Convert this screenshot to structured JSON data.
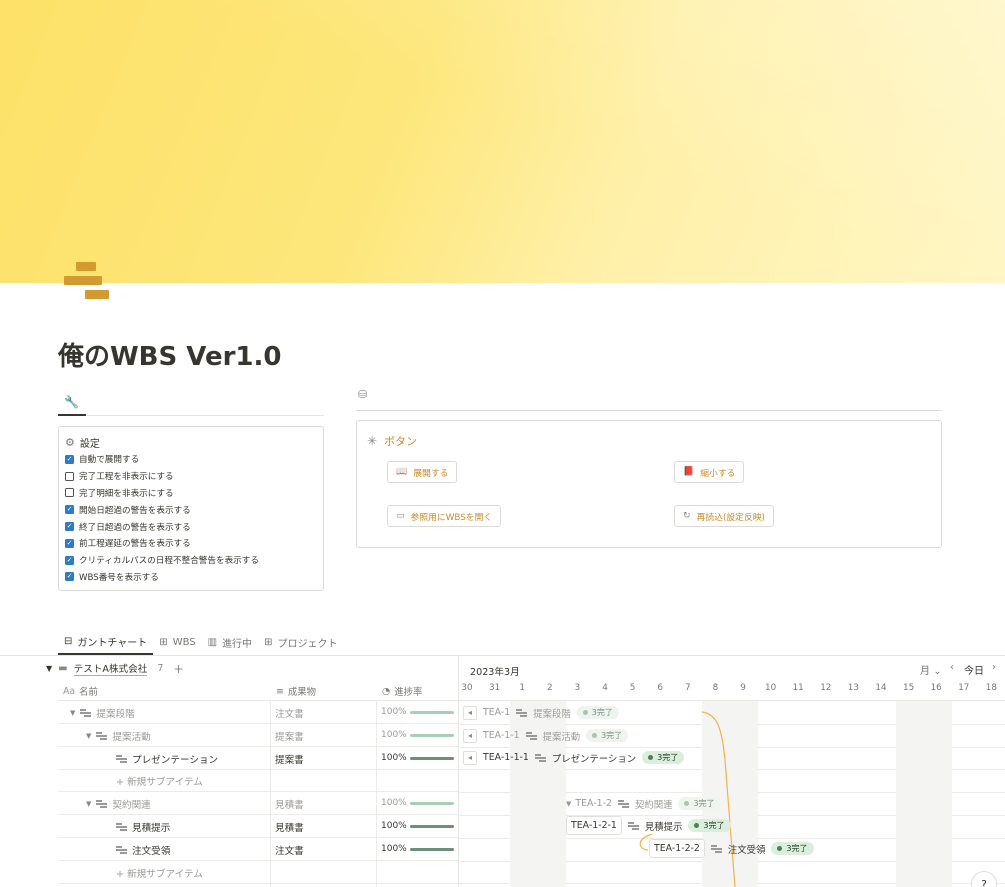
{
  "page": {
    "title": "俺のWBS Ver1.0"
  },
  "settings": {
    "tab_icon": "wrench-icon",
    "heading": "設定",
    "options": [
      {
        "label": "自動で展開する",
        "checked": true
      },
      {
        "label": "完了工程を非表示にする",
        "checked": false
      },
      {
        "label": "完了明細を非表示にする",
        "checked": false
      },
      {
        "label": "開始日超過の警告を表示する",
        "checked": true
      },
      {
        "label": "終了日超過の警告を表示する",
        "checked": true
      },
      {
        "label": "前工程遅延の警告を表示する",
        "checked": true
      },
      {
        "label": "クリティカルパスの日程不整合警告を表示する",
        "checked": true
      },
      {
        "label": "WBS番号を表示する",
        "checked": true
      }
    ]
  },
  "buttons": {
    "title": "ボタン",
    "expand": "展開する",
    "collapse": "縮小する",
    "open_ref": "参照用にWBSを開く",
    "reload": "再読込(設定反映)"
  },
  "views": [
    "ガントチャート",
    "WBS",
    "進行中",
    "プロジェクト"
  ],
  "table": {
    "group": {
      "name": "テストA株式会社",
      "count": "7"
    },
    "headers": {
      "name": "名前",
      "name_prefix": "Aa",
      "deliverable": "成果物",
      "progress": "進捗率"
    },
    "rows": [
      {
        "name": "提案段階",
        "deliverable": "注文書",
        "progress": "100%"
      },
      {
        "name": "提案活動",
        "deliverable": "提案書",
        "progress": "100%"
      },
      {
        "name": "プレゼンテーション",
        "deliverable": "提案書",
        "progress": "100%"
      },
      {
        "name": "新規サブアイテム"
      },
      {
        "name": "契約関連",
        "deliverable": "見積書",
        "progress": "100%"
      },
      {
        "name": "見積提示",
        "deliverable": "見積書",
        "progress": "100%"
      },
      {
        "name": "注文受領",
        "deliverable": "注文書",
        "progress": "100%"
      },
      {
        "name": "新規サブアイテム"
      }
    ]
  },
  "gantt": {
    "month": "2023年3月",
    "scale": "月",
    "today": "今日",
    "days": [
      "30",
      "31",
      "1",
      "2",
      "3",
      "4",
      "5",
      "6",
      "7",
      "8",
      "9",
      "10",
      "11",
      "12",
      "13",
      "14",
      "15",
      "16",
      "17",
      "18"
    ],
    "items": [
      {
        "wbs": "TEA-1",
        "name": "提案段階",
        "status": "3完了"
      },
      {
        "wbs": "TEA-1-1",
        "name": "提案活動",
        "status": "3完了"
      },
      {
        "wbs": "TEA-1-1-1",
        "name": "プレゼンテーション",
        "status": "3完了"
      },
      {
        "wbs": "TEA-1-2",
        "name": "契約関連",
        "status": "3完了"
      },
      {
        "wbs": "TEA-1-2-1",
        "name": "見積提示",
        "status": "3完了"
      },
      {
        "wbs": "TEA-1-2-2",
        "name": "注文受領",
        "status": "3完了"
      }
    ]
  },
  "help": "?"
}
